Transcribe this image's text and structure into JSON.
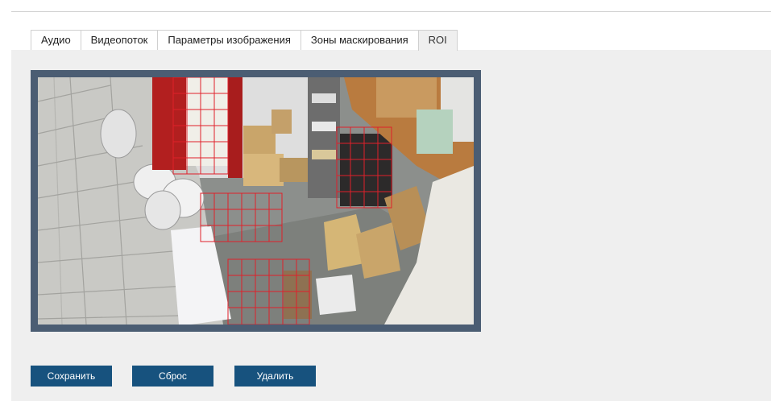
{
  "tabs": [
    {
      "label": "Аудио",
      "active": false
    },
    {
      "label": "Видеопоток",
      "active": false
    },
    {
      "label": "Параметры изображения",
      "active": false
    },
    {
      "label": "Зоны маскирования",
      "active": false
    },
    {
      "label": "ROI",
      "active": true
    }
  ],
  "buttons": {
    "save_label": "Сохранить",
    "reset_label": "Сброс",
    "delete_label": "Удалить"
  },
  "colors": {
    "accent": "#17527e",
    "frame": "#4b5d73",
    "roi_grid": "#e0202a",
    "panel_bg": "#efefef"
  }
}
